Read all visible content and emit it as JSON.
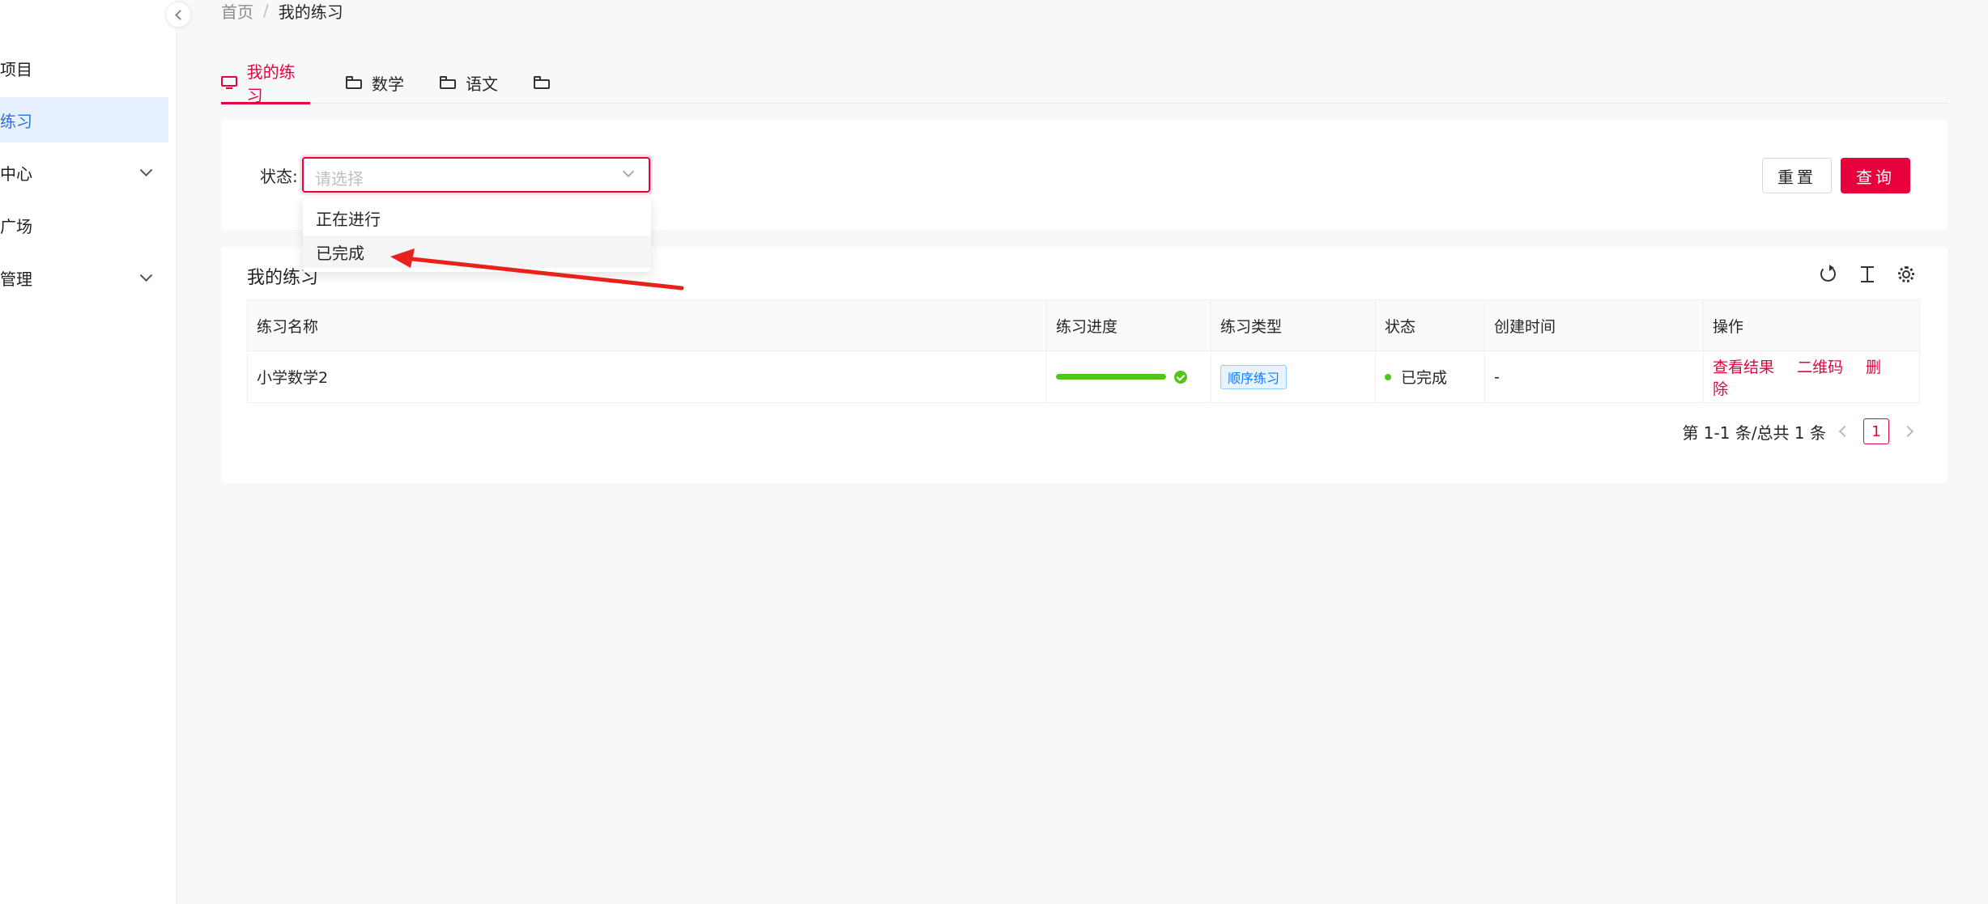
{
  "sidebar": {
    "items": [
      {
        "label": "项目"
      },
      {
        "label": "练习"
      },
      {
        "label": "中心"
      },
      {
        "label": "广场"
      },
      {
        "label": "管理"
      }
    ]
  },
  "breadcrumb": {
    "home": "首页",
    "separator": "/",
    "current": "我的练习"
  },
  "tabs": [
    {
      "label": "我的练习"
    },
    {
      "label": "数学"
    },
    {
      "label": "语文"
    },
    {
      "label": ""
    }
  ],
  "filter": {
    "status_label": "状态:",
    "status_placeholder": "请选择",
    "reset_label": "重置",
    "query_label": "查询"
  },
  "dropdown": {
    "options": [
      "正在进行",
      "已完成"
    ]
  },
  "table": {
    "title": "我的练习",
    "columns": [
      "练习名称",
      "练习进度",
      "练习类型",
      "状态",
      "创建时间",
      "操作"
    ],
    "rows": [
      {
        "name": "小学数学2",
        "progress": 1.0,
        "type": "顺序练习",
        "status": "已完成",
        "created": "-",
        "actions": [
          "查看结果",
          "二维码",
          "删除"
        ]
      }
    ]
  },
  "pagination": {
    "summary": "第 1-1 条/总共 1 条",
    "current_page": "1"
  },
  "colors": {
    "accent": "#e8003d",
    "success": "#52c41a",
    "tag_blue": "#1677ff",
    "sidebar_active": "#e6f0ff"
  }
}
